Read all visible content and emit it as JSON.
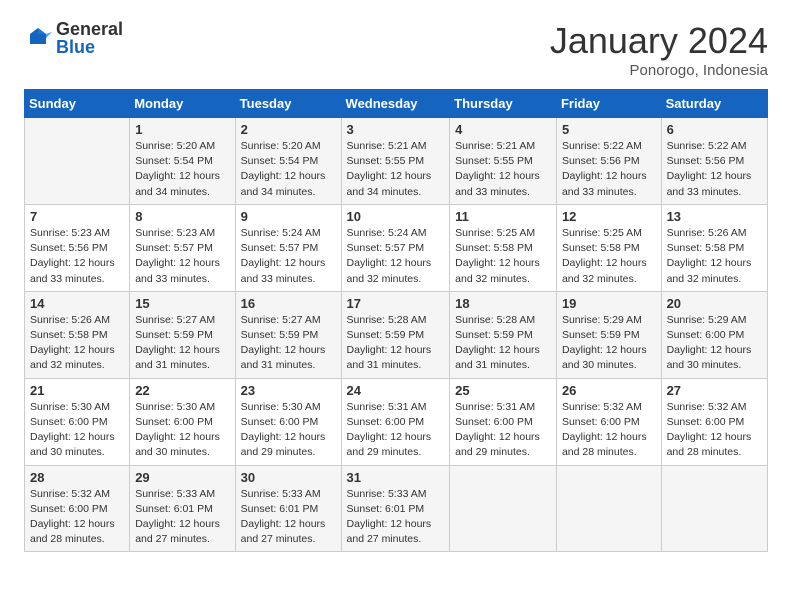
{
  "logo": {
    "general": "General",
    "blue": "Blue"
  },
  "title": "January 2024",
  "subtitle": "Ponorogo, Indonesia",
  "days_of_week": [
    "Sunday",
    "Monday",
    "Tuesday",
    "Wednesday",
    "Thursday",
    "Friday",
    "Saturday"
  ],
  "weeks": [
    [
      {
        "day": "",
        "info": ""
      },
      {
        "day": "1",
        "info": "Sunrise: 5:20 AM\nSunset: 5:54 PM\nDaylight: 12 hours\nand 34 minutes."
      },
      {
        "day": "2",
        "info": "Sunrise: 5:20 AM\nSunset: 5:54 PM\nDaylight: 12 hours\nand 34 minutes."
      },
      {
        "day": "3",
        "info": "Sunrise: 5:21 AM\nSunset: 5:55 PM\nDaylight: 12 hours\nand 34 minutes."
      },
      {
        "day": "4",
        "info": "Sunrise: 5:21 AM\nSunset: 5:55 PM\nDaylight: 12 hours\nand 33 minutes."
      },
      {
        "day": "5",
        "info": "Sunrise: 5:22 AM\nSunset: 5:56 PM\nDaylight: 12 hours\nand 33 minutes."
      },
      {
        "day": "6",
        "info": "Sunrise: 5:22 AM\nSunset: 5:56 PM\nDaylight: 12 hours\nand 33 minutes."
      }
    ],
    [
      {
        "day": "7",
        "info": "Sunrise: 5:23 AM\nSunset: 5:56 PM\nDaylight: 12 hours\nand 33 minutes."
      },
      {
        "day": "8",
        "info": "Sunrise: 5:23 AM\nSunset: 5:57 PM\nDaylight: 12 hours\nand 33 minutes."
      },
      {
        "day": "9",
        "info": "Sunrise: 5:24 AM\nSunset: 5:57 PM\nDaylight: 12 hours\nand 33 minutes."
      },
      {
        "day": "10",
        "info": "Sunrise: 5:24 AM\nSunset: 5:57 PM\nDaylight: 12 hours\nand 32 minutes."
      },
      {
        "day": "11",
        "info": "Sunrise: 5:25 AM\nSunset: 5:58 PM\nDaylight: 12 hours\nand 32 minutes."
      },
      {
        "day": "12",
        "info": "Sunrise: 5:25 AM\nSunset: 5:58 PM\nDaylight: 12 hours\nand 32 minutes."
      },
      {
        "day": "13",
        "info": "Sunrise: 5:26 AM\nSunset: 5:58 PM\nDaylight: 12 hours\nand 32 minutes."
      }
    ],
    [
      {
        "day": "14",
        "info": "Sunrise: 5:26 AM\nSunset: 5:58 PM\nDaylight: 12 hours\nand 32 minutes."
      },
      {
        "day": "15",
        "info": "Sunrise: 5:27 AM\nSunset: 5:59 PM\nDaylight: 12 hours\nand 31 minutes."
      },
      {
        "day": "16",
        "info": "Sunrise: 5:27 AM\nSunset: 5:59 PM\nDaylight: 12 hours\nand 31 minutes."
      },
      {
        "day": "17",
        "info": "Sunrise: 5:28 AM\nSunset: 5:59 PM\nDaylight: 12 hours\nand 31 minutes."
      },
      {
        "day": "18",
        "info": "Sunrise: 5:28 AM\nSunset: 5:59 PM\nDaylight: 12 hours\nand 31 minutes."
      },
      {
        "day": "19",
        "info": "Sunrise: 5:29 AM\nSunset: 5:59 PM\nDaylight: 12 hours\nand 30 minutes."
      },
      {
        "day": "20",
        "info": "Sunrise: 5:29 AM\nSunset: 6:00 PM\nDaylight: 12 hours\nand 30 minutes."
      }
    ],
    [
      {
        "day": "21",
        "info": "Sunrise: 5:30 AM\nSunset: 6:00 PM\nDaylight: 12 hours\nand 30 minutes."
      },
      {
        "day": "22",
        "info": "Sunrise: 5:30 AM\nSunset: 6:00 PM\nDaylight: 12 hours\nand 30 minutes."
      },
      {
        "day": "23",
        "info": "Sunrise: 5:30 AM\nSunset: 6:00 PM\nDaylight: 12 hours\nand 29 minutes."
      },
      {
        "day": "24",
        "info": "Sunrise: 5:31 AM\nSunset: 6:00 PM\nDaylight: 12 hours\nand 29 minutes."
      },
      {
        "day": "25",
        "info": "Sunrise: 5:31 AM\nSunset: 6:00 PM\nDaylight: 12 hours\nand 29 minutes."
      },
      {
        "day": "26",
        "info": "Sunrise: 5:32 AM\nSunset: 6:00 PM\nDaylight: 12 hours\nand 28 minutes."
      },
      {
        "day": "27",
        "info": "Sunrise: 5:32 AM\nSunset: 6:00 PM\nDaylight: 12 hours\nand 28 minutes."
      }
    ],
    [
      {
        "day": "28",
        "info": "Sunrise: 5:32 AM\nSunset: 6:00 PM\nDaylight: 12 hours\nand 28 minutes."
      },
      {
        "day": "29",
        "info": "Sunrise: 5:33 AM\nSunset: 6:01 PM\nDaylight: 12 hours\nand 27 minutes."
      },
      {
        "day": "30",
        "info": "Sunrise: 5:33 AM\nSunset: 6:01 PM\nDaylight: 12 hours\nand 27 minutes."
      },
      {
        "day": "31",
        "info": "Sunrise: 5:33 AM\nSunset: 6:01 PM\nDaylight: 12 hours\nand 27 minutes."
      },
      {
        "day": "",
        "info": ""
      },
      {
        "day": "",
        "info": ""
      },
      {
        "day": "",
        "info": ""
      }
    ]
  ]
}
